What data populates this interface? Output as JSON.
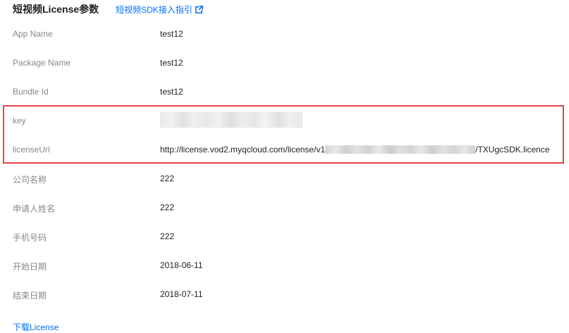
{
  "header": {
    "title": "短视频License参数",
    "guide_link": "短视频SDK接入指引"
  },
  "rows": [
    {
      "label": "App Name",
      "value": "test12"
    },
    {
      "label": "Package Name",
      "value": "test12"
    },
    {
      "label": "Bundle Id",
      "value": "test12"
    },
    {
      "label": "key",
      "value": ""
    },
    {
      "label": "licenseUrl",
      "value_prefix": "http://license.vod2.myqcloud.com/license/v1",
      "value_suffix": "/TXUgcSDK.licence"
    },
    {
      "label": "公司名称",
      "value": "222"
    },
    {
      "label": "申请人姓名",
      "value": "222"
    },
    {
      "label": "手机号码",
      "value": "222"
    },
    {
      "label": "开始日期",
      "value": "2018-06-11"
    },
    {
      "label": "结束日期",
      "value": "2018-07-11"
    }
  ],
  "footer": {
    "download_link": "下载License"
  },
  "colors": {
    "link": "#006eff",
    "highlight_border": "#e54545",
    "label": "#888888",
    "value": "#222222"
  },
  "icons": {
    "guide_link_icon": "external-link-icon"
  }
}
